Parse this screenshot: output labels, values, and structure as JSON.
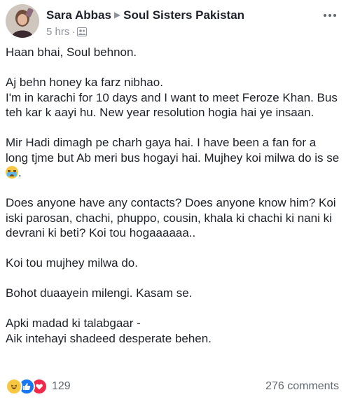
{
  "header": {
    "author": "Sara Abbas",
    "group": "Soul Sisters Pakistan",
    "time": "5 hrs",
    "separator": "·",
    "audience_icon": "group-members-icon",
    "more_icon": "more-options-icon"
  },
  "post": {
    "paragraphs": [
      "Haan bhai, Soul behnon.",
      "Aj behn honey ka farz nibhao.\nI'm in karachi for 10 days and I want to meet Feroze Khan. Bus teh kar k aayi hu. New year resolution hogia hai ye insaan.",
      "Mir Hadi dimagh pe charh gaya hai. I have been a fan for a long tjme but Ab meri bus hogayi hai. Mujhey koi milwa do is se",
      "Does anyone have any contacts? Does anyone know him? Koi iski parosan, chachi, phuppo, cousin, khala ki chachi ki nani ki devrani ki beti? Koi tou hogaaaaaa..",
      "Koi tou mujhey milwa do.",
      "Bohot duaayein milengi. Kasam se.",
      "Apki madad ki talabgaar -\nAik intehayi shadeed desperate behen."
    ],
    "emoji_after_p3": "crying-emoji",
    "p3_trailing": "."
  },
  "footer": {
    "reactions": [
      "haha",
      "like",
      "love"
    ],
    "reaction_count": "129",
    "comments": "276 comments"
  },
  "colors": {
    "text": "#1d2129",
    "secondary": "#90949c",
    "like": "#1877f2",
    "love": "#f0284a",
    "haha": "#f7c744"
  }
}
